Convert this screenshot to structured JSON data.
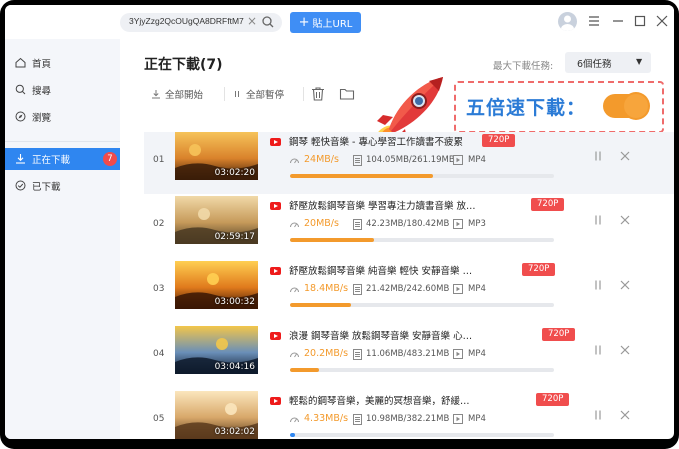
{
  "titlebar": {
    "url_value": "3YjyZzg2QcOUgQA8DRFftM7zc",
    "paste_label": "貼上URL"
  },
  "sidebar": {
    "items": [
      {
        "label": "首頁",
        "icon": "home-icon"
      },
      {
        "label": "搜尋",
        "icon": "search-icon"
      },
      {
        "label": "瀏覽",
        "icon": "compass-icon"
      },
      {
        "label": "正在下載",
        "icon": "download-icon",
        "badge": "7",
        "active": true
      },
      {
        "label": "已下載",
        "icon": "check-circle-icon"
      }
    ]
  },
  "main": {
    "title": "正在下載(7)",
    "max_tasks_label": "最大下載任務:",
    "max_tasks_value": "6個任務",
    "start_all_label": "全部開始",
    "pause_all_label": "全部暫停"
  },
  "promo": {
    "text": "五倍速下載：",
    "toggle_on": true
  },
  "colors": {
    "accent": "#2f86f0",
    "progress": "#f39a2c",
    "badge": "#f04d4d"
  },
  "downloads": [
    {
      "num": "01",
      "duration": "03:02:20",
      "title": "鋼琴 輕快音樂 - 專心學習工作讀書不疲累",
      "resolution": "720P",
      "speed": "24MB/s",
      "size": "104.05MB/261.19MB",
      "format": "MP4",
      "progress": 0.54
    },
    {
      "num": "02",
      "duration": "02:59:17",
      "title": "舒壓放鬆鋼琴音樂 學習專注力讀書音樂 放鬆音樂 Best ...",
      "resolution": "720P",
      "speed": "20MB/s",
      "size": "42.23MB/180.42MB",
      "format": "MP3",
      "progress": 0.32
    },
    {
      "num": "03",
      "duration": "03:00:32",
      "title": "舒壓放鬆鋼琴音樂 純音樂 輕快 安靜音樂 心靈音樂 背...",
      "resolution": "720P",
      "speed": "18.4MB/s",
      "size": "21.42MB/242.60MB",
      "format": "MP4",
      "progress": 0.23
    },
    {
      "num": "04",
      "duration": "03:04:16",
      "title": "浪漫 鋼琴音樂 放鬆鋼琴音樂 安靜音樂 心靈音樂 背景音樂",
      "resolution": "720P",
      "speed": "20.2MB/s",
      "size": "11.06MB/483.21MB",
      "format": "MP4",
      "progress": 0.11
    },
    {
      "num": "05",
      "duration": "03:02:02",
      "title": "輕鬆的鋼琴音樂，美麗的冥想音樂，舒緩的睡眠音樂，...",
      "resolution": "720P",
      "speed": "4.33MB/s",
      "size": "10.98MB/382.21MB",
      "format": "MP4",
      "progress": 0.02
    }
  ]
}
